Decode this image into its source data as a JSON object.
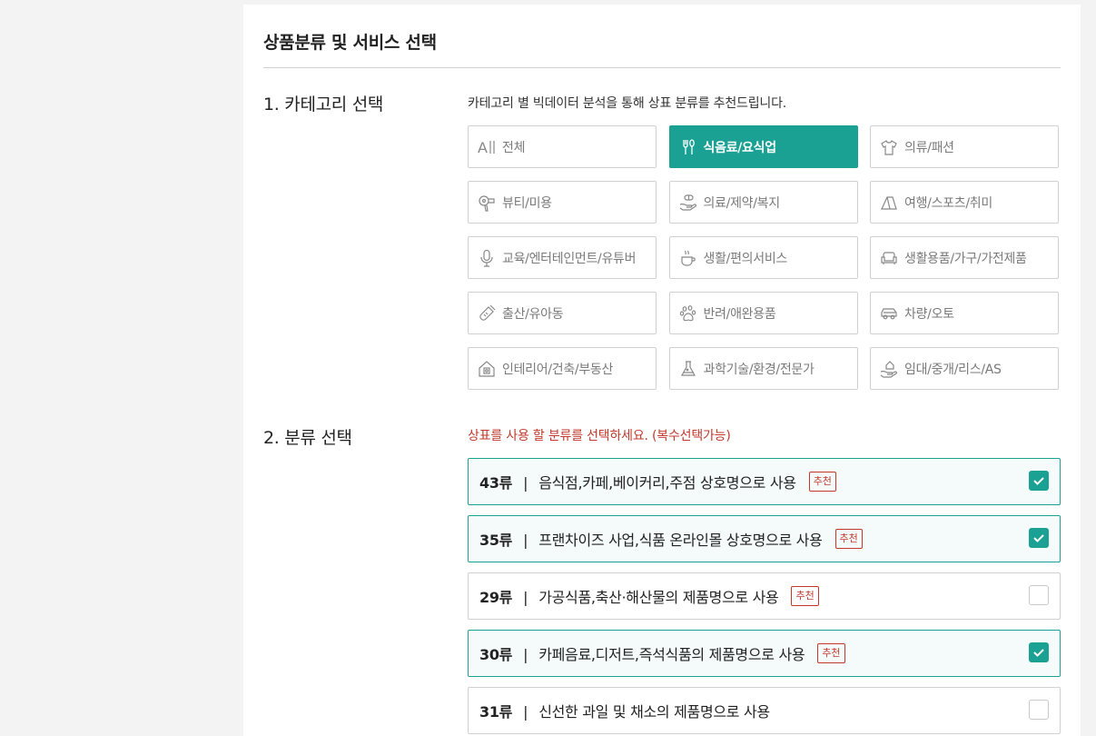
{
  "page": {
    "title": "상품분류 및 서비스 선택"
  },
  "category_section": {
    "label": "1. 카테고리 선택",
    "description": "카테고리 별 빅데이터 분석을 통해 상표 분류를 추천드립니다.",
    "items": [
      {
        "label": "전체",
        "icon": "all-icon",
        "selected": false
      },
      {
        "label": "식음료/요식업",
        "icon": "fork-spoon-icon",
        "selected": true
      },
      {
        "label": "의류/패션",
        "icon": "tshirt-icon",
        "selected": false
      },
      {
        "label": "뷰티/미용",
        "icon": "hair-dryer-icon",
        "selected": false
      },
      {
        "label": "의료/제약/복지",
        "icon": "pill-hand-icon",
        "selected": false
      },
      {
        "label": "여행/스포츠/취미",
        "icon": "tent-icon",
        "selected": false
      },
      {
        "label": "교육/엔터테인먼트/유튜버",
        "icon": "microphone-icon",
        "selected": false
      },
      {
        "label": "생활/편의서비스",
        "icon": "coffee-cup-icon",
        "selected": false
      },
      {
        "label": "생활용품/가구/가전제품",
        "icon": "sofa-icon",
        "selected": false
      },
      {
        "label": "출산/유아동",
        "icon": "baby-bottle-icon",
        "selected": false
      },
      {
        "label": "반려/애완용품",
        "icon": "paw-icon",
        "selected": false
      },
      {
        "label": "차량/오토",
        "icon": "car-icon",
        "selected": false
      },
      {
        "label": "인테리어/건축/부동산",
        "icon": "house-icon",
        "selected": false
      },
      {
        "label": "과학기술/환경/전문가",
        "icon": "flask-icon",
        "selected": false
      },
      {
        "label": "임대/중개/리스/AS",
        "icon": "hand-house-icon",
        "selected": false
      }
    ]
  },
  "classification_section": {
    "label": "2. 분류 선택",
    "description": "상표를 사용 할 분류를 선택하세요. (복수선택가능)",
    "separator": "|",
    "badge_label": "추천",
    "items": [
      {
        "code": "43류",
        "desc": "음식점,카페,베이커리,주점 상호명으로 사용",
        "recommended": true,
        "checked": true
      },
      {
        "code": "35류",
        "desc": "프랜차이즈 사업,식품 온라인몰 상호명으로 사용",
        "recommended": true,
        "checked": true
      },
      {
        "code": "29류",
        "desc": "가공식품,축산·해산물의 제품명으로 사용",
        "recommended": true,
        "checked": false
      },
      {
        "code": "30류",
        "desc": "카페음료,디저트,즉석식품의 제품명으로 사용",
        "recommended": true,
        "checked": true
      },
      {
        "code": "31류",
        "desc": "신선한 과일 및 채소의 제품명으로 사용",
        "recommended": false,
        "checked": false
      }
    ]
  },
  "colors": {
    "accent": "#1aa193",
    "warning": "#c0392b",
    "border": "#d0d0d0"
  }
}
